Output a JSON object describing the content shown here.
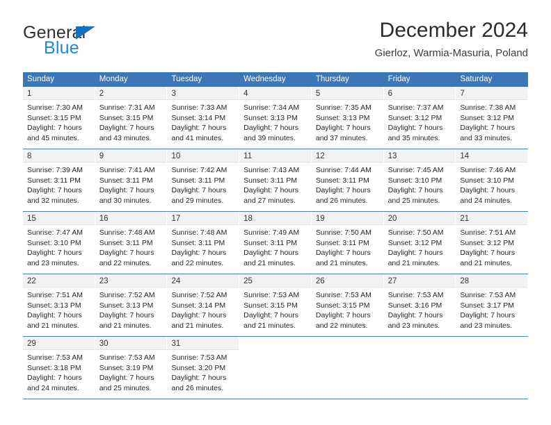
{
  "brand": {
    "name_part1": "General",
    "name_part2": "Blue",
    "triangle_color": "#1271c1",
    "blue_color": "#1f86d8"
  },
  "header": {
    "title": "December 2024",
    "subtitle": "Gierloz, Warmia-Masuria, Poland"
  },
  "theme": {
    "header_row_bg": "#3a76b8",
    "header_row_text": "#ffffff",
    "day_band_bg": "#f2f2f2",
    "row_divider": "#4a7fbd"
  },
  "weekdays": [
    "Sunday",
    "Monday",
    "Tuesday",
    "Wednesday",
    "Thursday",
    "Friday",
    "Saturday"
  ],
  "weeks": [
    [
      {
        "day": "1",
        "sunrise": "Sunrise: 7:30 AM",
        "sunset": "Sunset: 3:15 PM",
        "daylight1": "Daylight: 7 hours",
        "daylight2": "and 45 minutes."
      },
      {
        "day": "2",
        "sunrise": "Sunrise: 7:31 AM",
        "sunset": "Sunset: 3:15 PM",
        "daylight1": "Daylight: 7 hours",
        "daylight2": "and 43 minutes."
      },
      {
        "day": "3",
        "sunrise": "Sunrise: 7:33 AM",
        "sunset": "Sunset: 3:14 PM",
        "daylight1": "Daylight: 7 hours",
        "daylight2": "and 41 minutes."
      },
      {
        "day": "4",
        "sunrise": "Sunrise: 7:34 AM",
        "sunset": "Sunset: 3:13 PM",
        "daylight1": "Daylight: 7 hours",
        "daylight2": "and 39 minutes."
      },
      {
        "day": "5",
        "sunrise": "Sunrise: 7:35 AM",
        "sunset": "Sunset: 3:13 PM",
        "daylight1": "Daylight: 7 hours",
        "daylight2": "and 37 minutes."
      },
      {
        "day": "6",
        "sunrise": "Sunrise: 7:37 AM",
        "sunset": "Sunset: 3:12 PM",
        "daylight1": "Daylight: 7 hours",
        "daylight2": "and 35 minutes."
      },
      {
        "day": "7",
        "sunrise": "Sunrise: 7:38 AM",
        "sunset": "Sunset: 3:12 PM",
        "daylight1": "Daylight: 7 hours",
        "daylight2": "and 33 minutes."
      }
    ],
    [
      {
        "day": "8",
        "sunrise": "Sunrise: 7:39 AM",
        "sunset": "Sunset: 3:11 PM",
        "daylight1": "Daylight: 7 hours",
        "daylight2": "and 32 minutes."
      },
      {
        "day": "9",
        "sunrise": "Sunrise: 7:41 AM",
        "sunset": "Sunset: 3:11 PM",
        "daylight1": "Daylight: 7 hours",
        "daylight2": "and 30 minutes."
      },
      {
        "day": "10",
        "sunrise": "Sunrise: 7:42 AM",
        "sunset": "Sunset: 3:11 PM",
        "daylight1": "Daylight: 7 hours",
        "daylight2": "and 29 minutes."
      },
      {
        "day": "11",
        "sunrise": "Sunrise: 7:43 AM",
        "sunset": "Sunset: 3:11 PM",
        "daylight1": "Daylight: 7 hours",
        "daylight2": "and 27 minutes."
      },
      {
        "day": "12",
        "sunrise": "Sunrise: 7:44 AM",
        "sunset": "Sunset: 3:11 PM",
        "daylight1": "Daylight: 7 hours",
        "daylight2": "and 26 minutes."
      },
      {
        "day": "13",
        "sunrise": "Sunrise: 7:45 AM",
        "sunset": "Sunset: 3:10 PM",
        "daylight1": "Daylight: 7 hours",
        "daylight2": "and 25 minutes."
      },
      {
        "day": "14",
        "sunrise": "Sunrise: 7:46 AM",
        "sunset": "Sunset: 3:10 PM",
        "daylight1": "Daylight: 7 hours",
        "daylight2": "and 24 minutes."
      }
    ],
    [
      {
        "day": "15",
        "sunrise": "Sunrise: 7:47 AM",
        "sunset": "Sunset: 3:10 PM",
        "daylight1": "Daylight: 7 hours",
        "daylight2": "and 23 minutes."
      },
      {
        "day": "16",
        "sunrise": "Sunrise: 7:48 AM",
        "sunset": "Sunset: 3:11 PM",
        "daylight1": "Daylight: 7 hours",
        "daylight2": "and 22 minutes."
      },
      {
        "day": "17",
        "sunrise": "Sunrise: 7:48 AM",
        "sunset": "Sunset: 3:11 PM",
        "daylight1": "Daylight: 7 hours",
        "daylight2": "and 22 minutes."
      },
      {
        "day": "18",
        "sunrise": "Sunrise: 7:49 AM",
        "sunset": "Sunset: 3:11 PM",
        "daylight1": "Daylight: 7 hours",
        "daylight2": "and 21 minutes."
      },
      {
        "day": "19",
        "sunrise": "Sunrise: 7:50 AM",
        "sunset": "Sunset: 3:11 PM",
        "daylight1": "Daylight: 7 hours",
        "daylight2": "and 21 minutes."
      },
      {
        "day": "20",
        "sunrise": "Sunrise: 7:50 AM",
        "sunset": "Sunset: 3:12 PM",
        "daylight1": "Daylight: 7 hours",
        "daylight2": "and 21 minutes."
      },
      {
        "day": "21",
        "sunrise": "Sunrise: 7:51 AM",
        "sunset": "Sunset: 3:12 PM",
        "daylight1": "Daylight: 7 hours",
        "daylight2": "and 21 minutes."
      }
    ],
    [
      {
        "day": "22",
        "sunrise": "Sunrise: 7:51 AM",
        "sunset": "Sunset: 3:13 PM",
        "daylight1": "Daylight: 7 hours",
        "daylight2": "and 21 minutes."
      },
      {
        "day": "23",
        "sunrise": "Sunrise: 7:52 AM",
        "sunset": "Sunset: 3:13 PM",
        "daylight1": "Daylight: 7 hours",
        "daylight2": "and 21 minutes."
      },
      {
        "day": "24",
        "sunrise": "Sunrise: 7:52 AM",
        "sunset": "Sunset: 3:14 PM",
        "daylight1": "Daylight: 7 hours",
        "daylight2": "and 21 minutes."
      },
      {
        "day": "25",
        "sunrise": "Sunrise: 7:53 AM",
        "sunset": "Sunset: 3:15 PM",
        "daylight1": "Daylight: 7 hours",
        "daylight2": "and 21 minutes."
      },
      {
        "day": "26",
        "sunrise": "Sunrise: 7:53 AM",
        "sunset": "Sunset: 3:15 PM",
        "daylight1": "Daylight: 7 hours",
        "daylight2": "and 22 minutes."
      },
      {
        "day": "27",
        "sunrise": "Sunrise: 7:53 AM",
        "sunset": "Sunset: 3:16 PM",
        "daylight1": "Daylight: 7 hours",
        "daylight2": "and 23 minutes."
      },
      {
        "day": "28",
        "sunrise": "Sunrise: 7:53 AM",
        "sunset": "Sunset: 3:17 PM",
        "daylight1": "Daylight: 7 hours",
        "daylight2": "and 23 minutes."
      }
    ],
    [
      {
        "day": "29",
        "sunrise": "Sunrise: 7:53 AM",
        "sunset": "Sunset: 3:18 PM",
        "daylight1": "Daylight: 7 hours",
        "daylight2": "and 24 minutes."
      },
      {
        "day": "30",
        "sunrise": "Sunrise: 7:53 AM",
        "sunset": "Sunset: 3:19 PM",
        "daylight1": "Daylight: 7 hours",
        "daylight2": "and 25 minutes."
      },
      {
        "day": "31",
        "sunrise": "Sunrise: 7:53 AM",
        "sunset": "Sunset: 3:20 PM",
        "daylight1": "Daylight: 7 hours",
        "daylight2": "and 26 minutes."
      },
      {
        "day": "",
        "sunrise": "",
        "sunset": "",
        "daylight1": "",
        "daylight2": ""
      },
      {
        "day": "",
        "sunrise": "",
        "sunset": "",
        "daylight1": "",
        "daylight2": ""
      },
      {
        "day": "",
        "sunrise": "",
        "sunset": "",
        "daylight1": "",
        "daylight2": ""
      },
      {
        "day": "",
        "sunrise": "",
        "sunset": "",
        "daylight1": "",
        "daylight2": ""
      }
    ]
  ]
}
